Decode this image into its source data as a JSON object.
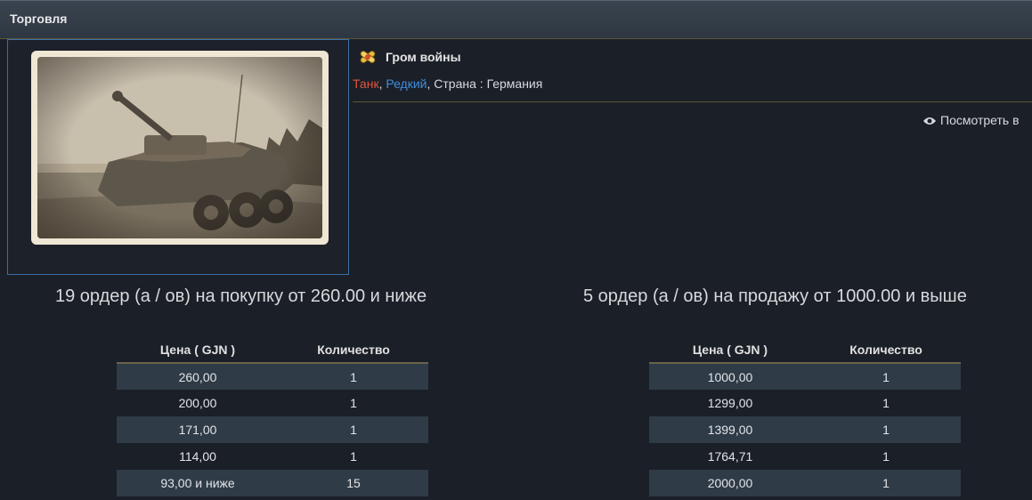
{
  "window": {
    "title": "Торговля"
  },
  "item": {
    "name": "Гром войны",
    "tags": {
      "type": "Танк",
      "rarity": "Редкий",
      "country_label": "Страна : Германия"
    },
    "view_link": "Посмотреть в"
  },
  "buy": {
    "heading": "19 ордер (а / ов) на покупку от 260.00 и ниже",
    "columns": {
      "price": "Цена ( GJN )",
      "qty": "Количество"
    },
    "rows": [
      {
        "price": "260,00",
        "qty": "1"
      },
      {
        "price": "200,00",
        "qty": "1"
      },
      {
        "price": "171,00",
        "qty": "1"
      },
      {
        "price": "114,00",
        "qty": "1"
      },
      {
        "price": "93,00 и ниже",
        "qty": "15"
      }
    ]
  },
  "sell": {
    "heading": "5 ордер (а / ов) на продажу от 1000.00 и выше",
    "columns": {
      "price": "Цена ( GJN )",
      "qty": "Количество"
    },
    "rows": [
      {
        "price": "1000,00",
        "qty": "1"
      },
      {
        "price": "1299,00",
        "qty": "1"
      },
      {
        "price": "1399,00",
        "qty": "1"
      },
      {
        "price": "1764,71",
        "qty": "1"
      },
      {
        "price": "2000,00",
        "qty": "1"
      }
    ]
  },
  "colors": {
    "tank": "#e0553c",
    "rare": "#3d8ee0",
    "row_alt": "#2f3b47",
    "accent_line": "#5a5238"
  },
  "icons": {
    "item": "crossed-shells-icon",
    "view": "eye-icon"
  }
}
